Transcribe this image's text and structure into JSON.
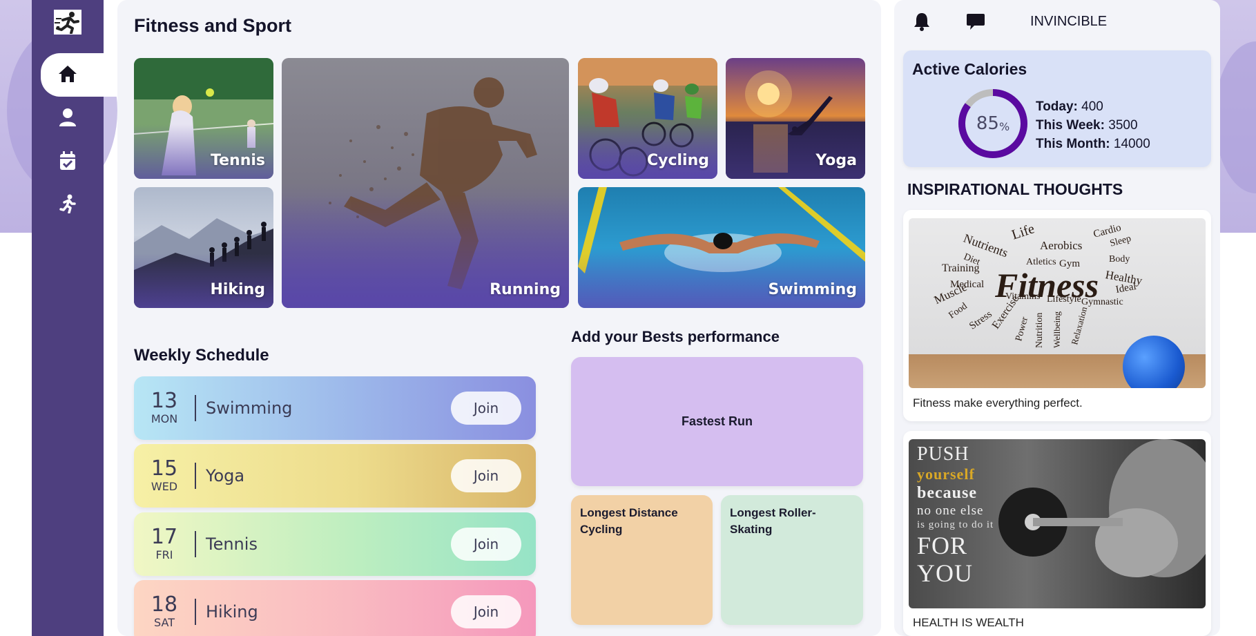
{
  "main": {
    "title": "Fitness and Sport",
    "sports": [
      {
        "label": "Tennis"
      },
      {
        "label": "Hiking"
      },
      {
        "label": "Running"
      },
      {
        "label": "Cycling"
      },
      {
        "label": "Yoga"
      },
      {
        "label": "Swimming"
      }
    ],
    "schedule": {
      "title": "Weekly Schedule",
      "items": [
        {
          "day": "13",
          "weekday": "MON",
          "activity": "Swimming",
          "action": "Join"
        },
        {
          "day": "15",
          "weekday": "WED",
          "activity": "Yoga",
          "action": "Join"
        },
        {
          "day": "17",
          "weekday": "FRI",
          "activity": "Tennis",
          "action": "Join"
        },
        {
          "day": "18",
          "weekday": "SAT",
          "activity": "Hiking",
          "action": "Join"
        }
      ]
    },
    "performance": {
      "title": "Add your Bests performance",
      "fastest": "Fastest Run",
      "cycling": "Longest Distance Cycling",
      "skating": "Longest Roller-Skating"
    }
  },
  "header": {
    "username": "INVINCIBLE"
  },
  "calories": {
    "title": "Active Calories",
    "percent": "85",
    "percent_unit": "%",
    "progress_fraction": 0.85,
    "today_label": "Today:",
    "today_value": "400",
    "week_label": "This Week:",
    "week_value": "3500",
    "month_label": "This Month:",
    "month_value": "14000"
  },
  "thoughts": {
    "title": "INSPIRATIONAL THOUGHTS",
    "cards": [
      {
        "caption": "Fitness make everything perfect.",
        "image_text": "Fitness"
      },
      {
        "caption": "HEALTH IS WEALTH",
        "image_lines": [
          "PUSH",
          "yourself",
          "because",
          "no one else",
          "is going to do it",
          "FOR",
          "YOU"
        ]
      }
    ],
    "wordcloud": [
      "Nutrients",
      "Life",
      "Aerobics",
      "Cardio",
      "Sleep",
      "Diet",
      "Atletics",
      "Gym",
      "Body",
      "Training",
      "Healthy",
      "Medical",
      "Ideal",
      "Muscle",
      "Vitamins",
      "Lifestyle",
      "Gymnastic",
      "Food",
      "Stress",
      "Exercise",
      "Power",
      "Nutrition",
      "Wellbeing",
      "Relaxation"
    ]
  },
  "colors": {
    "sidebar": "#4e3f7f",
    "accent": "#5a1aa0",
    "panel": "#f3f4f9"
  }
}
